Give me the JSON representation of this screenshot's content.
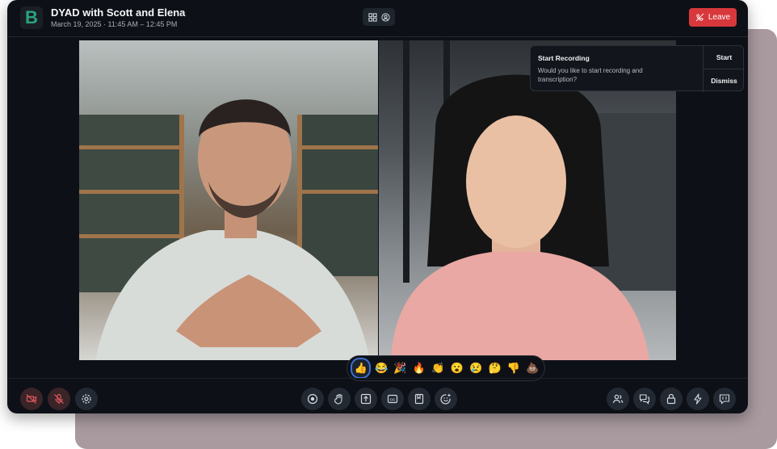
{
  "header": {
    "logo_letter": "B",
    "meeting_title": "DYAD with Scott and Elena",
    "meeting_time": "March 19, 2025 · 11:45 AM – 12:45 PM",
    "leave_label": "Leave"
  },
  "recording_prompt": {
    "title": "Start Recording",
    "description": "Would you like to start recording and transcription?",
    "start_label": "Start",
    "dismiss_label": "Dismiss"
  },
  "reactions": [
    "👍",
    "😂",
    "🎉",
    "🔥",
    "👏",
    "😮",
    "😢",
    "🤔",
    "👎",
    "💩"
  ],
  "toolbar": {
    "left": [
      "camera-off",
      "mic-off",
      "settings"
    ],
    "center": [
      "record",
      "raise-hand",
      "share-screen",
      "captions",
      "notes",
      "reactions"
    ],
    "right": [
      "participants",
      "chat",
      "lock",
      "actions",
      "transcript"
    ]
  },
  "colors": {
    "background": "#0d1117",
    "leave": "#d8383c",
    "brand": "#2ba37e",
    "accent": "#3d6fd3"
  }
}
